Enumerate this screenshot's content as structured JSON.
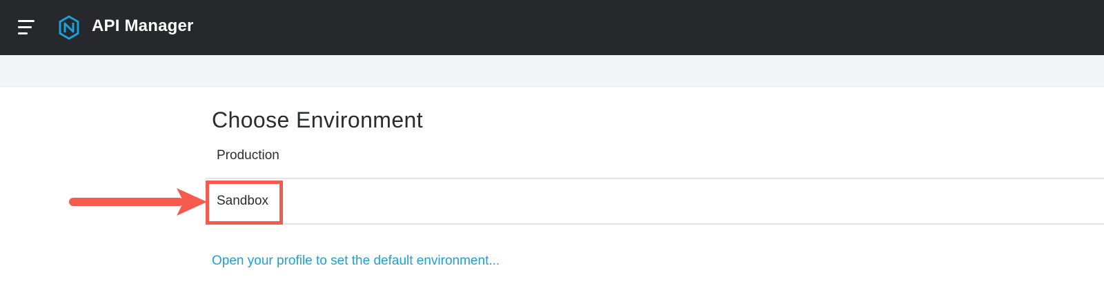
{
  "header": {
    "app_title": "API Manager",
    "menu_icon": "hamburger-menu-icon",
    "logo_icon": "api-manager-logo-icon",
    "background_color": "#27282b",
    "logo_color": "#1aa1d8"
  },
  "main": {
    "title": "Choose Environment",
    "environments": [
      {
        "label": "Production"
      },
      {
        "label": "Sandbox",
        "highlighted": true
      }
    ],
    "profile_link": "Open your profile to set the default environment..."
  },
  "annotation": {
    "arrow_icon": "arrow-right-icon",
    "color": "#f45b4e"
  }
}
